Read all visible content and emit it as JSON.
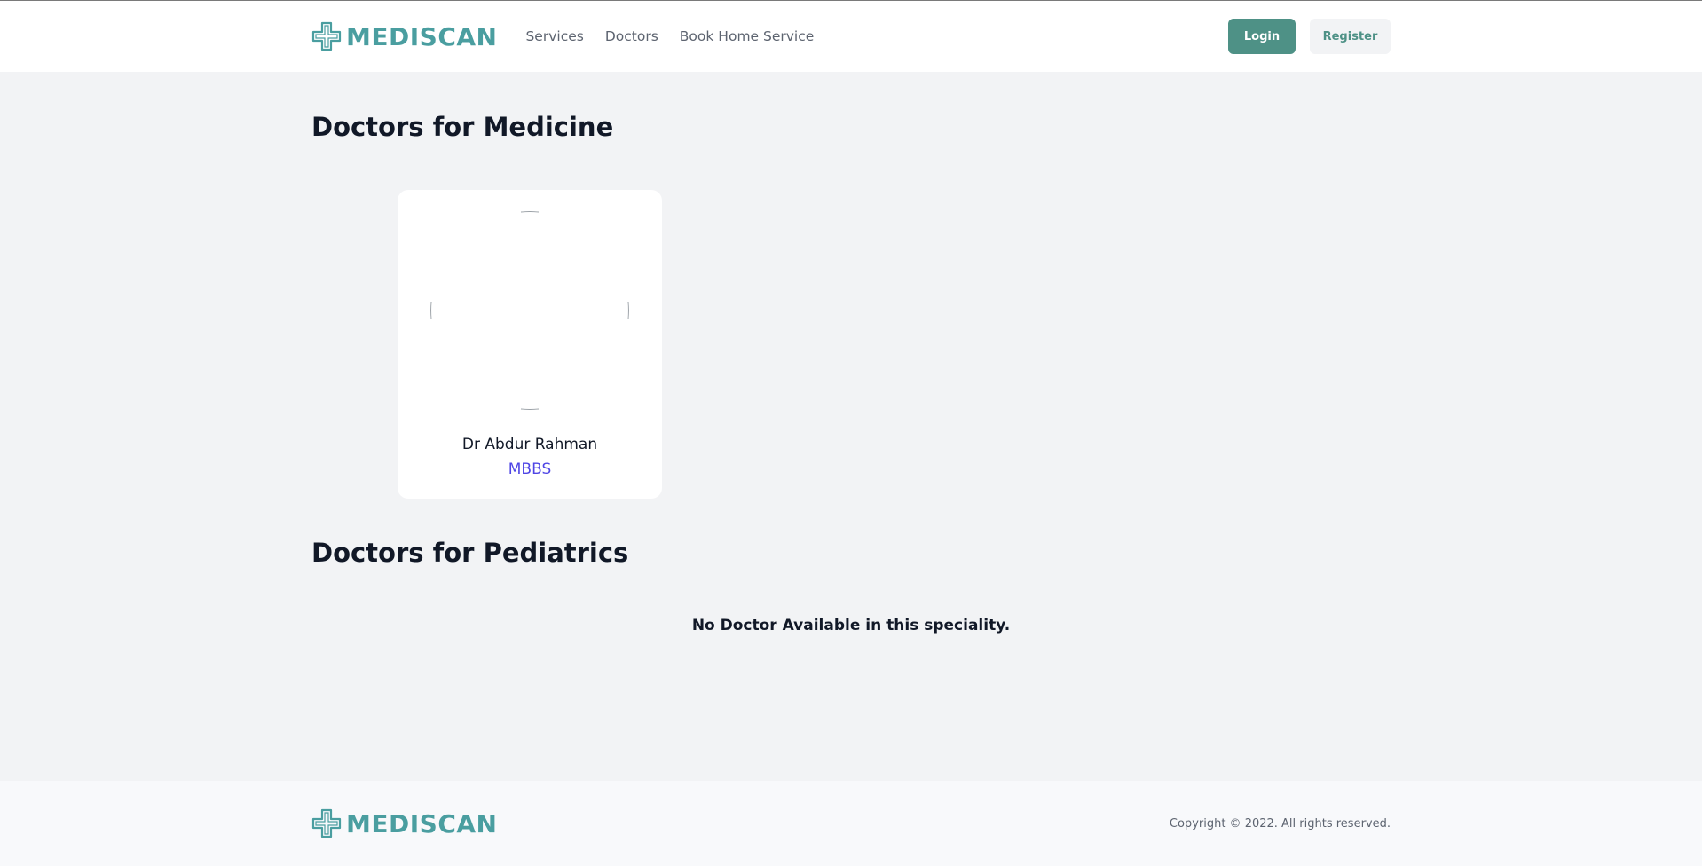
{
  "header": {
    "brand": "MEDISCAN",
    "nav": [
      "Services",
      "Doctors",
      "Book Home Service"
    ],
    "login_label": "Login",
    "register_label": "Register"
  },
  "sections": [
    {
      "title": "Doctors for Medicine",
      "doctors": [
        {
          "name": "Dr Abdur Rahman",
          "degree": "MBBS"
        }
      ]
    },
    {
      "title": "Doctors for Pediatrics",
      "empty_message": "No Doctor Available in this speciality."
    }
  ],
  "footer": {
    "brand": "MEDISCAN",
    "copyright": "Copyright © 2022. All rights reserved."
  },
  "colors": {
    "brand": "#4a9ea0",
    "primary_button": "#4e9186",
    "degree_text": "#4f46e5",
    "page_background": "#f2f3f5"
  }
}
